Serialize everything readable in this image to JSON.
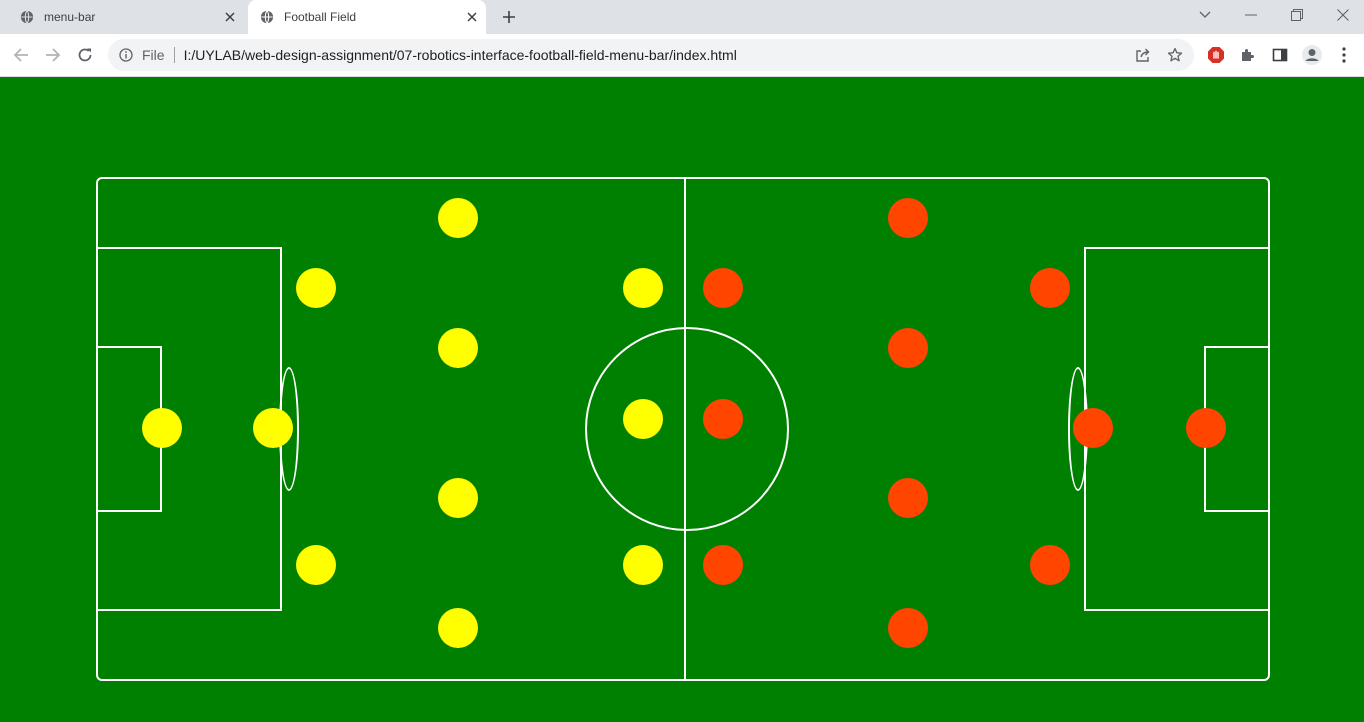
{
  "browser": {
    "tabs": [
      {
        "title": "menu-bar",
        "active": false
      },
      {
        "title": "Football Field",
        "active": true
      }
    ],
    "address": {
      "scheme_label": "File",
      "url": "I:/UYLAB/web-design-assignment/07-robotics-interface-football-field-menu-bar/index.html"
    }
  },
  "colors": {
    "pitch": "#008000",
    "lines": "#ffffff",
    "team_yellow": "#ffff00",
    "team_orange": "#ff4500"
  },
  "teams": {
    "yellow": {
      "player_count": 11
    },
    "orange": {
      "player_count": 11
    }
  }
}
